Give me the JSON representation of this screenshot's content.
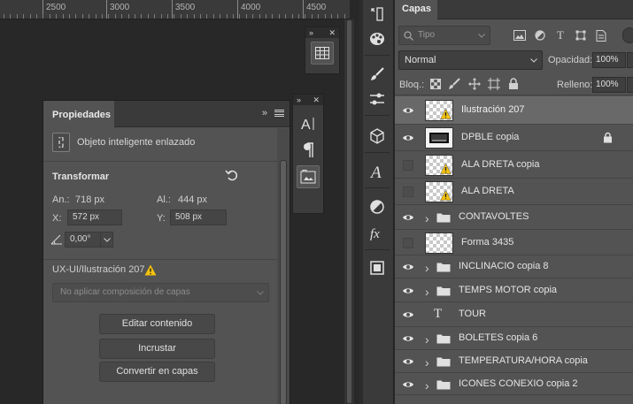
{
  "ruler": {
    "marks": [
      "2500",
      "3000",
      "3500",
      "4000",
      "4500"
    ]
  },
  "properties": {
    "tab_label": "Propiedades",
    "collapse": "»",
    "object_type": "Objeto inteligente enlazado",
    "transform_heading": "Transformar",
    "w_label": "An.:",
    "w_value": "718 px",
    "h_label": "Al.:",
    "h_value": "444 px",
    "x_label": "X:",
    "x_value": "572 px",
    "y_label": "Y:",
    "y_value": "508 px",
    "angle_value": "0,00°",
    "linked_file": "UX-UI/Ilustración 207",
    "comp_placeholder": "No aplicar composición de capas",
    "btn_edit": "Editar contenido",
    "btn_embed": "Incrustar",
    "btn_convert": "Convertir en capas"
  },
  "layers": {
    "tab_label": "Capas",
    "search_placeholder": "Tipo",
    "blend_mode": "Normal",
    "opacity_label": "Opacidad:",
    "opacity_value": "100%",
    "lock_label": "Bloq.:",
    "fill_label": "Relleno:",
    "fill_value": "100%",
    "items": [
      {
        "name": "Ilustración 207",
        "visible": true,
        "kind": "smart",
        "selected": true
      },
      {
        "name": "DPBLE copia",
        "visible": true,
        "kind": "image",
        "locked": true
      },
      {
        "name": "ALA DRETA copia",
        "visible": false,
        "kind": "smart"
      },
      {
        "name": "ALA DRETA",
        "visible": false,
        "kind": "smart"
      },
      {
        "name": "CONTAVOLTES",
        "visible": true,
        "kind": "group"
      },
      {
        "name": "Forma 3435",
        "visible": false,
        "kind": "shape"
      },
      {
        "name": "INCLINACIO copia 8",
        "visible": true,
        "kind": "group"
      },
      {
        "name": "TEMPS MOTOR copia",
        "visible": true,
        "kind": "group"
      },
      {
        "name": "TOUR",
        "visible": true,
        "kind": "text"
      },
      {
        "name": "BOLETES copia 6",
        "visible": true,
        "kind": "group"
      },
      {
        "name": "TEMPERATURA/HORA copia",
        "visible": true,
        "kind": "group"
      },
      {
        "name": "ICONES CONEXIO copia 2",
        "visible": true,
        "kind": "group"
      }
    ]
  },
  "colors": {
    "panel": "#535353",
    "header": "#3a3a3a",
    "canvas": "#282828",
    "selected_row": "#696969",
    "warning": "#f4c20d"
  },
  "icons": [
    "history-icon",
    "color-palette-icon",
    "brush-settings-icon",
    "adjustments-icon",
    "3d-cube-icon",
    "glyphs-icon",
    "mask-icon",
    "fx-icon",
    "artboard-icon",
    "table-icon",
    "character-icon",
    "paragraph-icon",
    "paragraph-styles-icon"
  ]
}
